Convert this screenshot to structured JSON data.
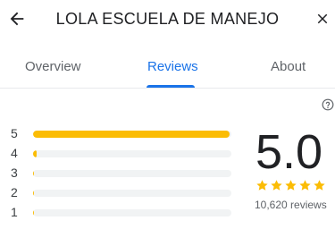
{
  "header": {
    "title": "LOLA ESCUELA DE MANEJO",
    "back_icon": "arrow-left-icon",
    "close_icon": "close-icon"
  },
  "tabs": [
    {
      "label": "Overview",
      "active": false
    },
    {
      "label": "Reviews",
      "active": true
    },
    {
      "label": "About",
      "active": false
    }
  ],
  "rating": {
    "score": "5.0",
    "stars": 5,
    "review_count": "10,620 reviews",
    "distribution": [
      {
        "label": "5",
        "fraction": 0.99
      },
      {
        "label": "4",
        "fraction": 0.02
      },
      {
        "label": "3",
        "fraction": 0.005
      },
      {
        "label": "2",
        "fraction": 0.005
      },
      {
        "label": "1",
        "fraction": 0.005
      }
    ]
  },
  "colors": {
    "accent": "#1a73e8",
    "star": "#fbbc04",
    "track": "#f1f3f4"
  },
  "icons": {
    "help": "help-icon",
    "star": "star-icon"
  }
}
